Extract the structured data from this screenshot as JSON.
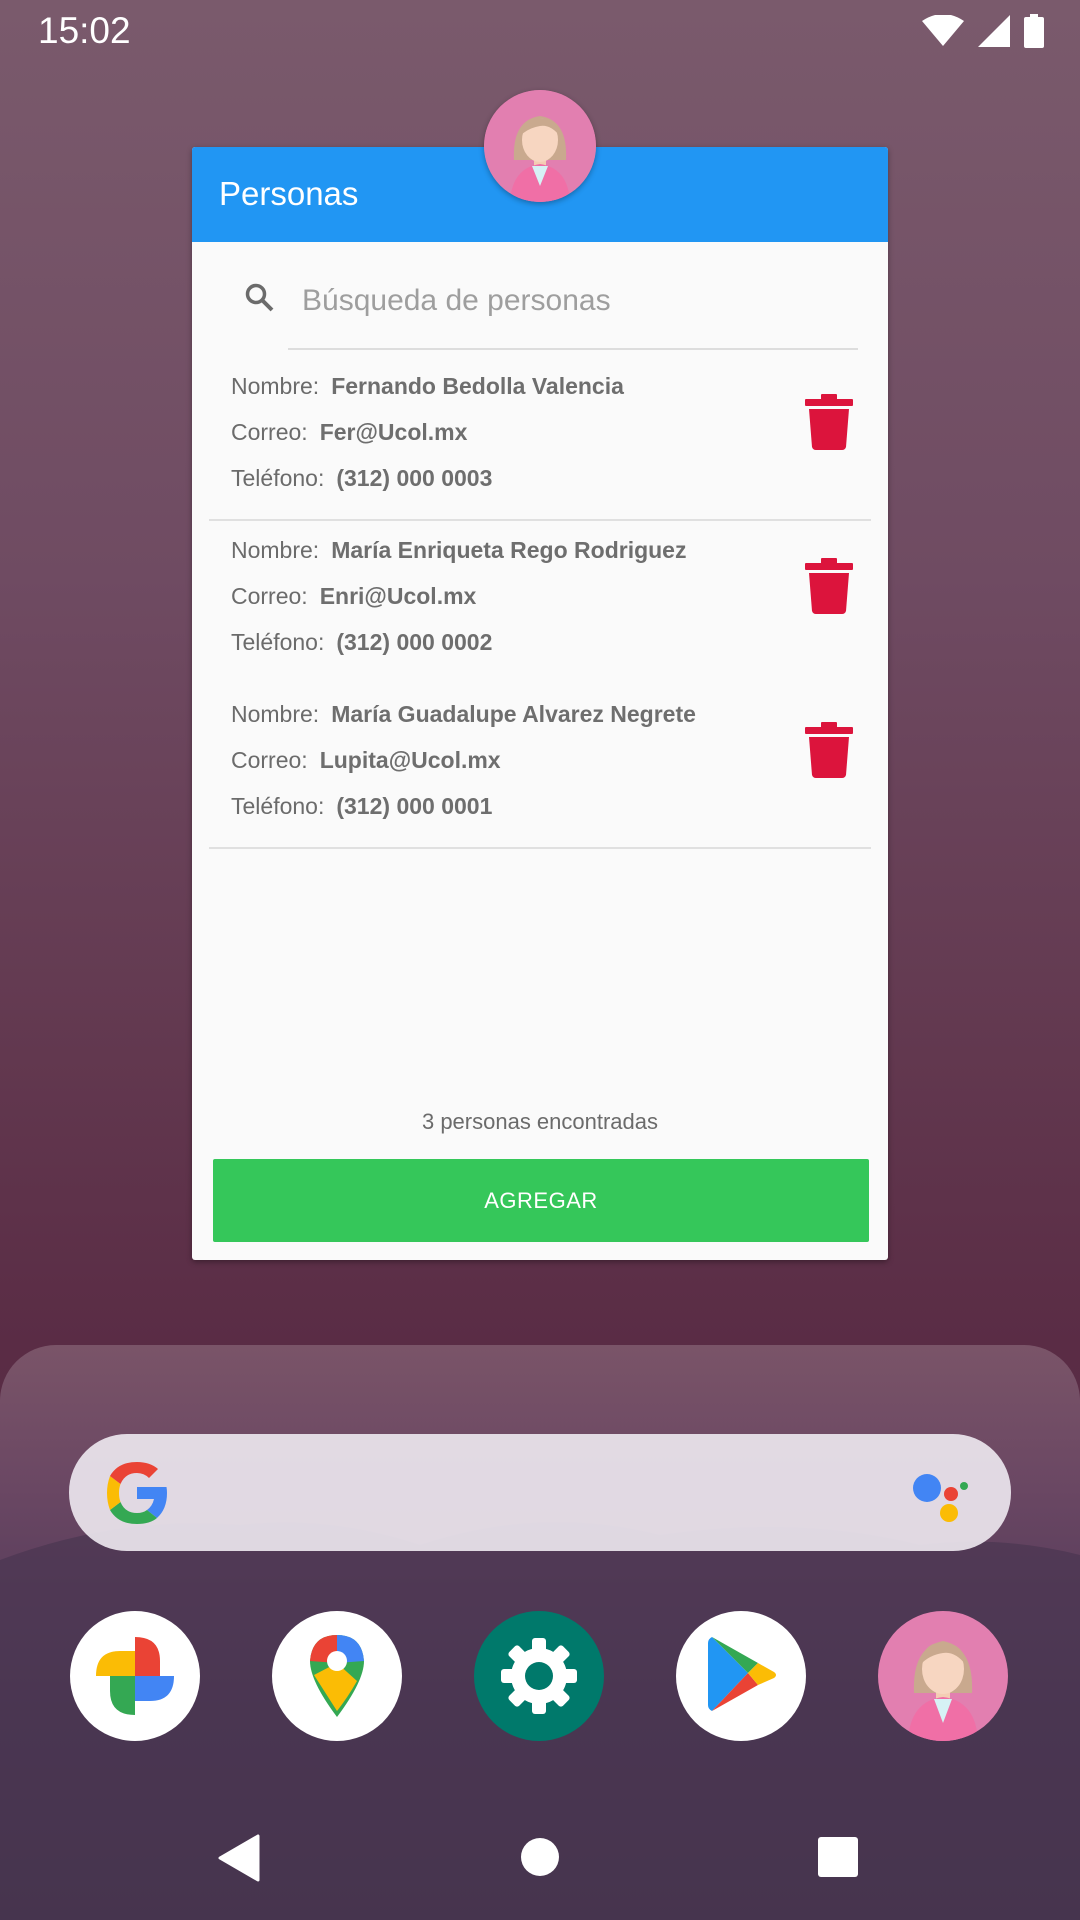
{
  "status_bar": {
    "time": "15:02"
  },
  "widget": {
    "title": "Personas",
    "search_placeholder": "Búsqueda de personas",
    "labels": {
      "name": "Nombre:",
      "email": "Correo:",
      "phone": "Teléfono:"
    },
    "persons": [
      {
        "name": "Fernando Bedolla Valencia",
        "email": "Fer@Ucol.mx",
        "phone": "(312) 000 0003"
      },
      {
        "name": "María Enriqueta Rego Rodriguez",
        "email": "Enri@Ucol.mx",
        "phone": "(312) 000 0002"
      },
      {
        "name": "María Guadalupe Alvarez Negrete",
        "email": "Lupita@Ucol.mx",
        "phone": "(312) 000 0001"
      }
    ],
    "count_text": "3 personas encontradas",
    "add_button": "AGREGAR"
  },
  "colors": {
    "header": "#2196f3",
    "delete": "#dc143c",
    "add_button": "#35c75a"
  },
  "dock_apps": [
    "google-photos-icon",
    "google-maps-icon",
    "settings-icon",
    "play-store-icon",
    "personas-app-icon"
  ],
  "nav": [
    "back-icon",
    "home-icon",
    "recents-icon"
  ]
}
